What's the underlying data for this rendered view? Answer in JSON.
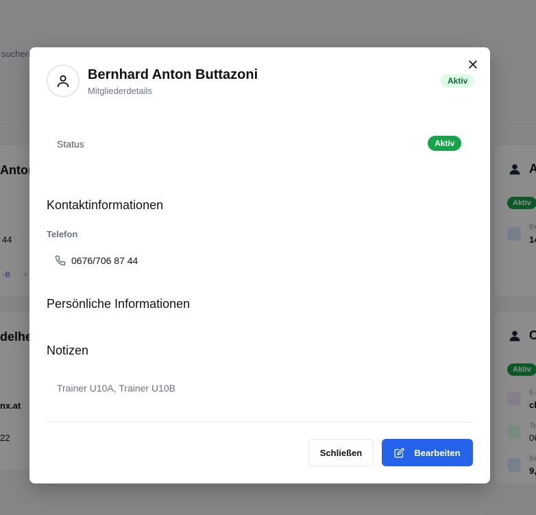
{
  "background": {
    "search_placeholder": "suchen",
    "card_left_top": {
      "name": "Anton",
      "phone": "44",
      "tag_a": "-B",
      "tag_b": "+"
    },
    "card_left_bottom": {
      "name": "delhe",
      "email": "nx.at",
      "phone": "22"
    },
    "card_right_top": {
      "name": "A",
      "badge": "Aktiv",
      "field_label": "Be",
      "field_value": "14"
    },
    "card_right_bottom": {
      "name": "C",
      "badge": "Aktiv",
      "email_label": "E-",
      "email_value": "ch",
      "phone_label": "Te",
      "phone_value": "06",
      "field_label": "Be",
      "field_value": "9,"
    }
  },
  "modal": {
    "title": "Bernhard Anton Buttazoni",
    "subtitle": "Mitgliederdetails",
    "header_badge": "Aktiv",
    "status": {
      "label": "Status",
      "value": "Aktiv"
    },
    "contact": {
      "heading": "Kontaktinformationen",
      "phone_label": "Telefon",
      "phone_value": "0676/706 87 44"
    },
    "personal": {
      "heading": "Persönliche Informationen"
    },
    "notes": {
      "heading": "Notizen",
      "text": "Trainer U10A, Trainer U10B"
    },
    "buttons": {
      "close_label": "Schließen",
      "edit_label": "Bearbeiten"
    }
  },
  "colors": {
    "accent_blue": "#2563eb",
    "status_green": "#16a34a",
    "status_green_light": "#dcfce7",
    "status_green_text": "#166534"
  },
  "icons": {
    "close": "close-icon",
    "avatar": "user-icon",
    "phone": "phone-icon",
    "edit": "edit-icon"
  }
}
